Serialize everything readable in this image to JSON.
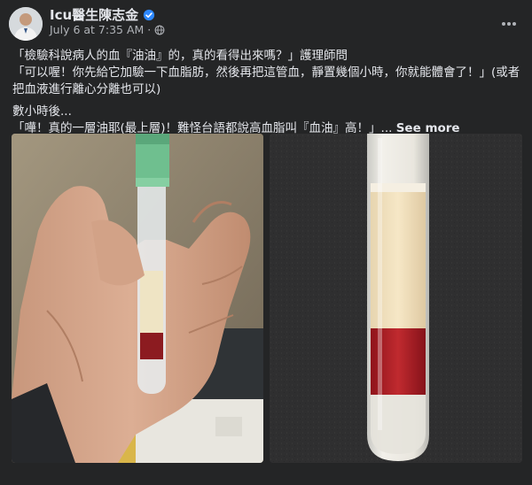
{
  "post": {
    "author": "Icu醫生陳志金",
    "timestamp": "July 6 at 7:35 AM",
    "separator": "·",
    "icons": {
      "verified": "verified-badge-icon",
      "audience": "globe-icon",
      "more": "more-options-icon"
    },
    "paragraphs": [
      "「檢驗科說病人的血『油油』的，真的看得出來嗎？」護理師問",
      "「可以喔！你先給它加驗一下血脂肪，然後再把這管血，靜置幾個小時，你就能體會了！」(或者把血液進行離心分離也可以)",
      "數小時後...",
      "「嘩！真的一層油耶(最上層)！難怪台語都說高血脂叫『血油』高！」... "
    ],
    "see_more": "See more",
    "colors": {
      "accent": "#2d88ff",
      "background": "#242526",
      "text": "#e4e6eb",
      "muted": "#b0b3b8"
    }
  }
}
